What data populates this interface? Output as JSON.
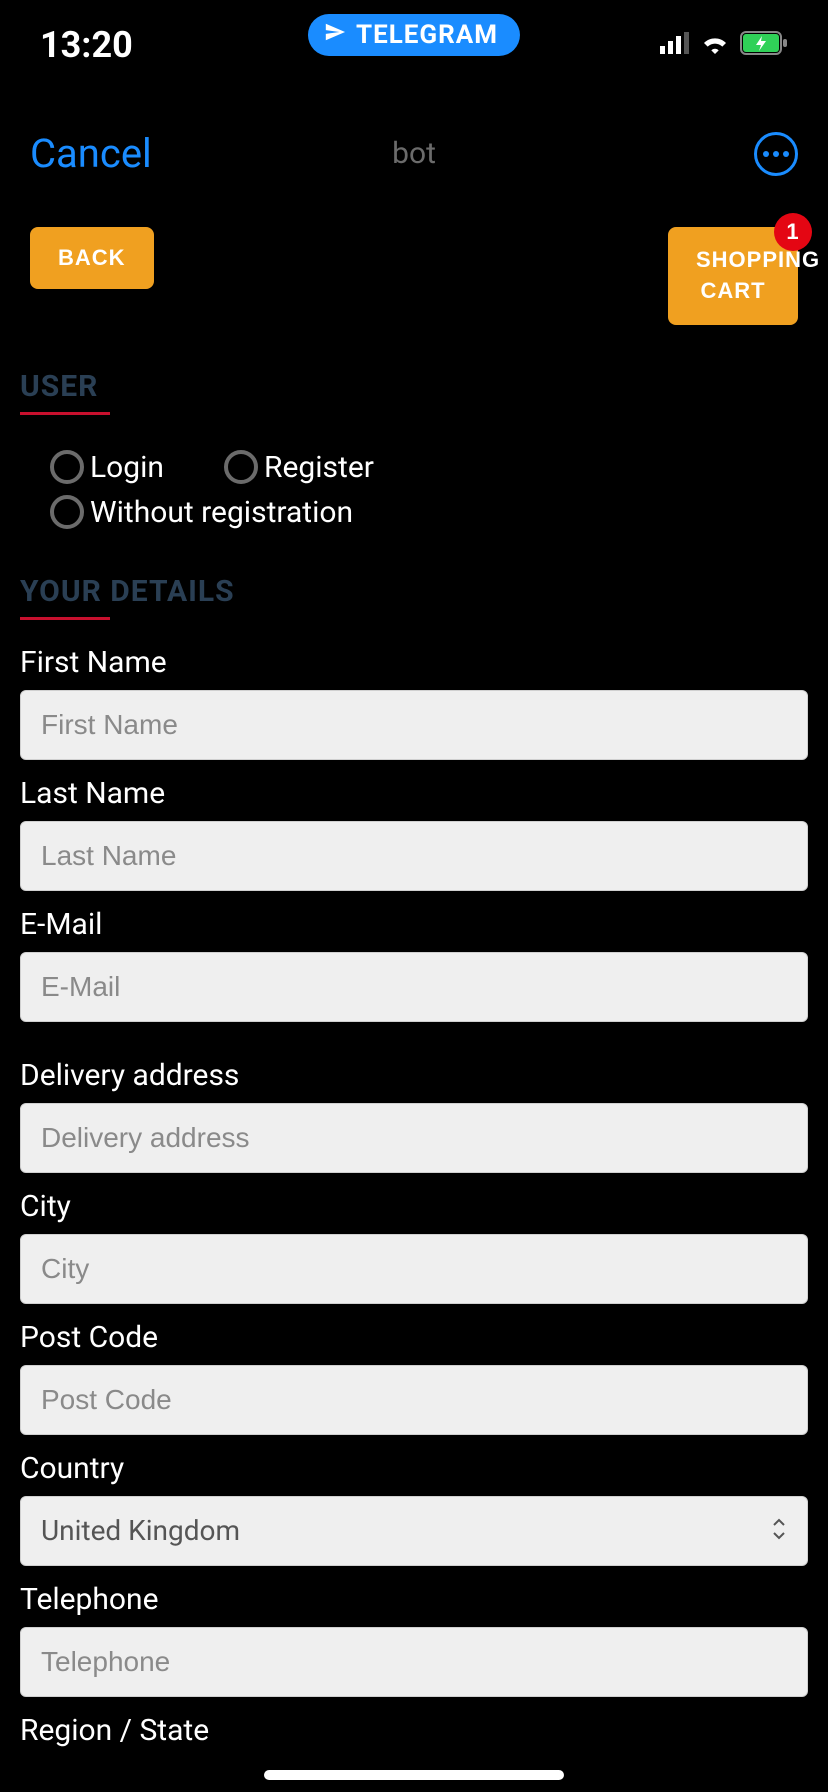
{
  "status": {
    "time": "13:20",
    "pill": "TELEGRAM"
  },
  "nav": {
    "cancel": "Cancel",
    "title": "bot"
  },
  "actions": {
    "back": "BACK",
    "cart": "SHOPPING CART",
    "badge": "1"
  },
  "sections": {
    "user": "USER",
    "details": "YOUR DETAILS"
  },
  "radios": {
    "login": "Login",
    "register": "Register",
    "without": "Without registration"
  },
  "fields": {
    "first_name": {
      "label": "First Name",
      "placeholder": "First Name"
    },
    "last_name": {
      "label": "Last Name",
      "placeholder": "Last Name"
    },
    "email": {
      "label": "E-Mail",
      "placeholder": "E-Mail"
    },
    "delivery": {
      "label": "Delivery address",
      "placeholder": "Delivery address"
    },
    "city": {
      "label": "City",
      "placeholder": "City"
    },
    "post_code": {
      "label": "Post Code",
      "placeholder": "Post Code"
    },
    "country": {
      "label": "Country",
      "value": "United Kingdom"
    },
    "telephone": {
      "label": "Telephone",
      "placeholder": "Telephone"
    },
    "region": {
      "label": "Region / State"
    }
  }
}
